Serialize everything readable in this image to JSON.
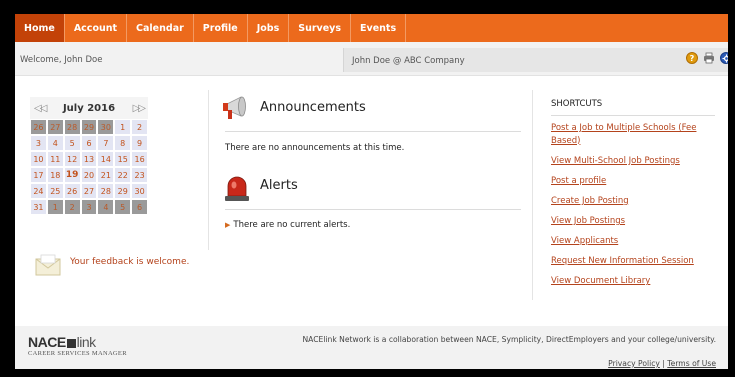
{
  "nav": {
    "items": [
      "Home",
      "Account",
      "Calendar",
      "Profile",
      "Jobs",
      "Surveys",
      "Events"
    ],
    "active": "Home",
    "color": "#ec6a1c"
  },
  "welcome": {
    "text": "Welcome, John Doe",
    "company": "John Doe @ ABC Company",
    "help_glyph": "?"
  },
  "calendar": {
    "prev_glyph": "◁◁",
    "next_glyph": "▷▷",
    "title": "July 2016",
    "weeks": [
      [
        "26",
        "27",
        "28",
        "29",
        "30",
        "1",
        "2"
      ],
      [
        "3",
        "4",
        "5",
        "6",
        "7",
        "8",
        "9"
      ],
      [
        "10",
        "11",
        "12",
        "13",
        "14",
        "15",
        "16"
      ],
      [
        "17",
        "18",
        "19",
        "20",
        "21",
        "22",
        "23"
      ],
      [
        "24",
        "25",
        "26",
        "27",
        "28",
        "29",
        "30"
      ],
      [
        "31",
        "1",
        "2",
        "3",
        "4",
        "5",
        "6"
      ]
    ],
    "today": "19"
  },
  "feedback": {
    "text": "Your feedback is welcome."
  },
  "announcements": {
    "title": "Announcements",
    "empty_text": "There are no announcements at this time."
  },
  "alerts": {
    "title": "Alerts",
    "empty_text": "There are no current alerts."
  },
  "shortcuts": {
    "title": "SHORTCUTS",
    "links": [
      "Post a Job to Multiple Schools (Fee Based)",
      "View Multi-School Job Postings",
      "Post a profile",
      "Create Job Posting",
      "View Job Postings",
      "View Applicants",
      "Request New Information Session",
      "View Document Library"
    ]
  },
  "footer": {
    "logo_brand": "NACE",
    "logo_link": "link",
    "logo_sub": "CAREER SERVICES MANAGER",
    "note": "NACElink Network is a collaboration between NACE, Symplicity, DirectEmployers and your college/university.",
    "privacy": "Privacy Policy",
    "separator": "|",
    "terms": "Terms of Use"
  }
}
